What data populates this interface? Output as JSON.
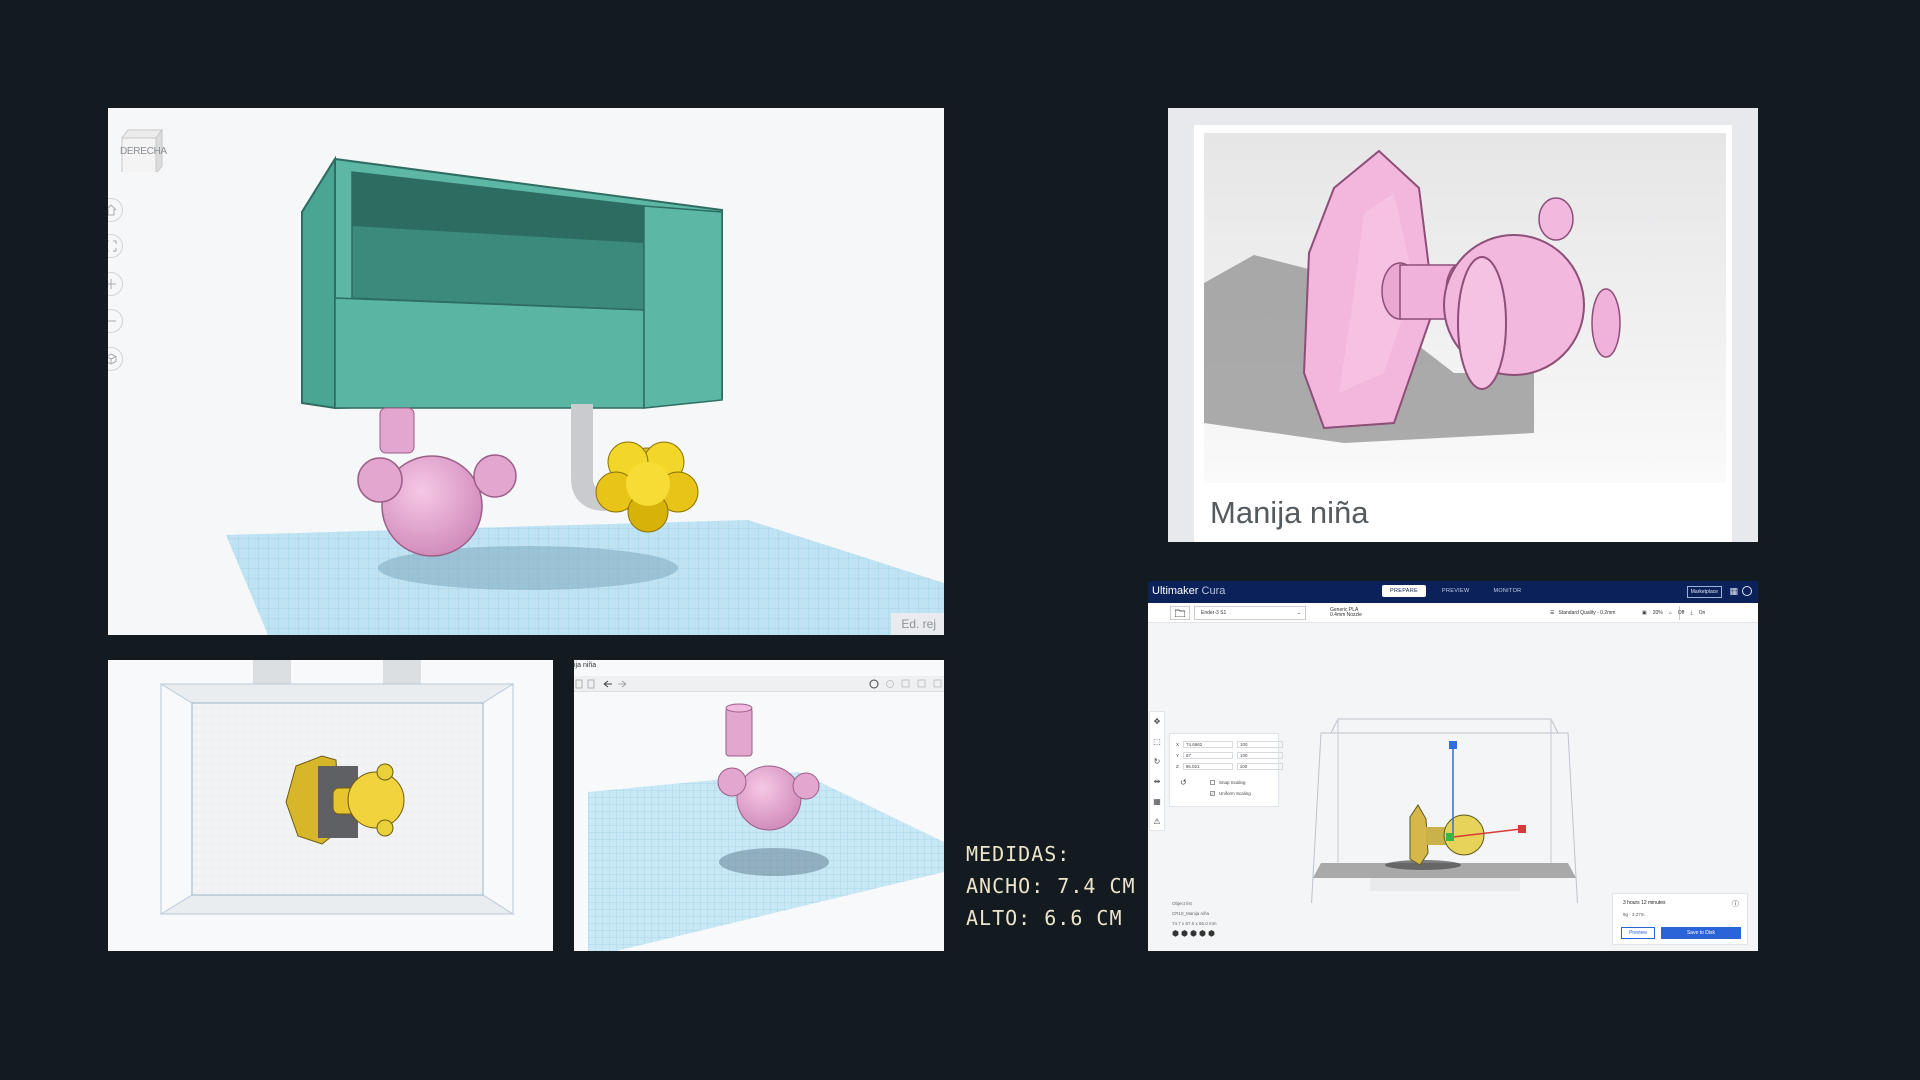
{
  "tinkercad": {
    "viewcube_label": "DERECHA",
    "grid_edit_label": "Ed. rej"
  },
  "photo_card": {
    "title": "Manija niña"
  },
  "tinkercad_small": {
    "tab_label": "ija niña"
  },
  "medidas": {
    "heading": "MEDIDAS:",
    "ancho": "ANCHO: 7.4 CM",
    "alto": "ALTO:  6.6 CM"
  },
  "cura": {
    "app_name": "Ultimaker",
    "app_name_light": "Cura",
    "tabs": [
      "PREPARE",
      "PREVIEW",
      "MONITOR"
    ],
    "marketplace": "Marketplace",
    "printer": "Ender-3 S1",
    "material_line1": "Generic PLA",
    "material_line2": "0.4mm Nozzle",
    "profile": "Standard Quality - 0.2mm",
    "infill": "20%",
    "support": "Off",
    "adhesion": "On",
    "scale_rows": [
      {
        "axis": "X",
        "mm": "74.6662",
        "unit": "mm",
        "pct": "100"
      },
      {
        "axis": "Y",
        "mm": "67",
        "unit": "mm",
        "pct": "100"
      },
      {
        "axis": "Z",
        "mm": "66.021",
        "unit": "mm",
        "pct": "100"
      }
    ],
    "snap_scaling": "Snap Scaling",
    "uniform_scaling": "Uniform Scaling",
    "object_list": "Object list",
    "object_name": "CR10_Manija niña",
    "object_dims": "74.7 x 67.0 x 66.0 mm",
    "print_time": "3 hours 12 minutes",
    "material_use": "9g · 3.27m",
    "preview_button": "Preview",
    "save_button": "Save to Disk"
  }
}
